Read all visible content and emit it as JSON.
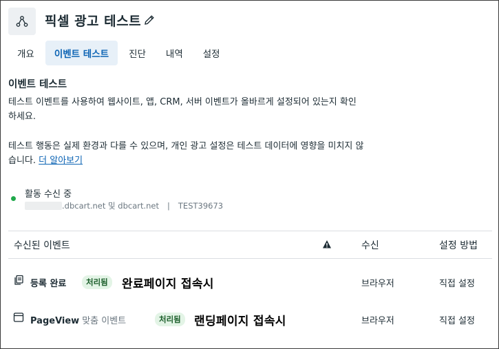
{
  "header": {
    "title": "픽셀 광고 테스트",
    "icon": "pixel-network-icon",
    "edit_icon": "pencil-icon"
  },
  "tabs": [
    {
      "label": "개요",
      "active": false
    },
    {
      "label": "이벤트 테스트",
      "active": true
    },
    {
      "label": "진단",
      "active": false
    },
    {
      "label": "내역",
      "active": false
    },
    {
      "label": "설정",
      "active": false
    }
  ],
  "section": {
    "title": "이벤트 테스트",
    "para1_line1": "테스트 이벤트를 사용하여 웹사이트, 앱, CRM, 서버 이벤트가 올바르게 설정되어 있는지 확인",
    "para1_line2": "하세요.",
    "para2_line1": "테스트 행동은 실제 환경과 다를 수 있으며, 개인 광고 설정은 테스트 데이터에 영향을 미치지 않",
    "para2_line2": "습니다.",
    "learn_more": "더 알아보기"
  },
  "status": {
    "text": "활동 수신 중",
    "domain": ".dbcart.net 및 dbcart.net",
    "separator": "|",
    "test_code": "TEST39673",
    "dot_color": "#1fa84a"
  },
  "table": {
    "headers": {
      "event": "수신된 이벤트",
      "warning_icon": "warning-icon",
      "received": "수신",
      "method": "설정 방법"
    },
    "rows": [
      {
        "icon": "copy-pages-icon",
        "name": "등록 완료",
        "subtype": "",
        "badge": "처리됨",
        "label": "완료페이지 접속시",
        "received": "브라우저",
        "method": "직접 설정"
      },
      {
        "icon": "browser-window-icon",
        "name": "PageView",
        "subtype": "맞춤 이벤트",
        "badge": "처리됨",
        "label": "랜딩페이지 접속시",
        "received": "브라우저",
        "method": "직접 설정"
      }
    ]
  },
  "colors": {
    "accent": "#0b63b4",
    "active_tab_bg": "#e7f0f8",
    "badge_bg": "#e3f4e6",
    "badge_text": "#1b5e2a"
  }
}
